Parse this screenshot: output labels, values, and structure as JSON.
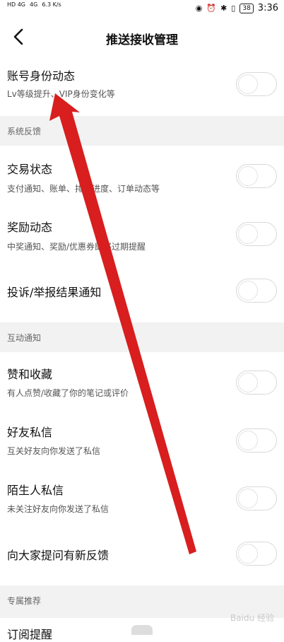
{
  "status_bar": {
    "network_1": "HD 4G",
    "network_2": "4G",
    "speed": "6.3 K/s",
    "battery": "38",
    "time": "3:36"
  },
  "header": {
    "title": "推送接收管理"
  },
  "rows": [
    {
      "title": "账号身份动态",
      "subtitle": "Lv等级提升、VIP身份变化等"
    },
    {
      "title": "交易状态",
      "subtitle": "支付通知、账单、排队进度、订单动态等"
    },
    {
      "title": "奖励动态",
      "subtitle": "中奖通知、奖励/优惠券即将过期提醒"
    },
    {
      "title": "投诉/举报结果通知",
      "subtitle": ""
    },
    {
      "title": "赞和收藏",
      "subtitle": "有人点赞/收藏了你的笔记或评价"
    },
    {
      "title": "好友私信",
      "subtitle": "互关好友向你发送了私信"
    },
    {
      "title": "陌生人私信",
      "subtitle": "未关注好友向你发送了私信"
    },
    {
      "title": "向大家提问有新反馈",
      "subtitle": ""
    }
  ],
  "sections": {
    "feedback": "系统反馈",
    "interaction": "互动通知",
    "recommend": "专属推荐"
  },
  "peek_row": {
    "title": "订阅提醒"
  },
  "watermark": "Baidu 经验",
  "colors": {
    "arrow": "#d81e1e",
    "section_bg": "#f2f2f2",
    "toggle_border": "#d8d8d8"
  }
}
